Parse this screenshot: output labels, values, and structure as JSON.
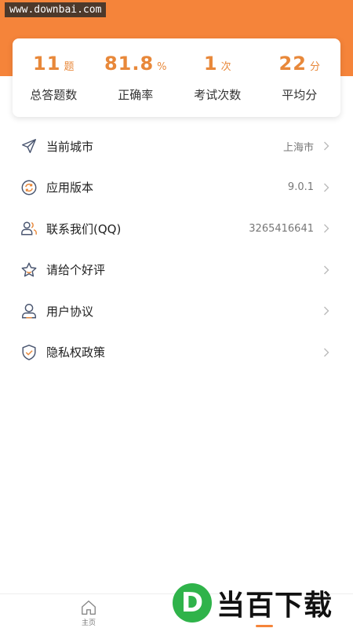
{
  "watermark": "www.downbai.com",
  "colors": {
    "accent": "#f5843a",
    "stat_value": "#e8883a",
    "brand_green": "#2fb34a"
  },
  "stats": [
    {
      "value": "11",
      "unit": "题",
      "label": "总答题数"
    },
    {
      "value": "81.8",
      "unit": "%",
      "label": "正确率"
    },
    {
      "value": "1",
      "unit": "次",
      "label": "考试次数"
    },
    {
      "value": "22",
      "unit": "分",
      "label": "平均分"
    }
  ],
  "menu": [
    {
      "icon": "send-icon",
      "label": "当前城市",
      "value": "上海市"
    },
    {
      "icon": "refresh-icon",
      "label": "应用版本",
      "value": "9.0.1"
    },
    {
      "icon": "contacts-icon",
      "label": "联系我们(QQ)",
      "value": "3265416641"
    },
    {
      "icon": "star-icon",
      "label": "请给个好评",
      "value": ""
    },
    {
      "icon": "user-icon",
      "label": "用户协议",
      "value": ""
    },
    {
      "icon": "shield-icon",
      "label": "隐私权政策",
      "value": ""
    }
  ],
  "tabbar": {
    "home_label": "主页"
  },
  "brand": {
    "badge_letter": "D",
    "text": "当百下载"
  }
}
